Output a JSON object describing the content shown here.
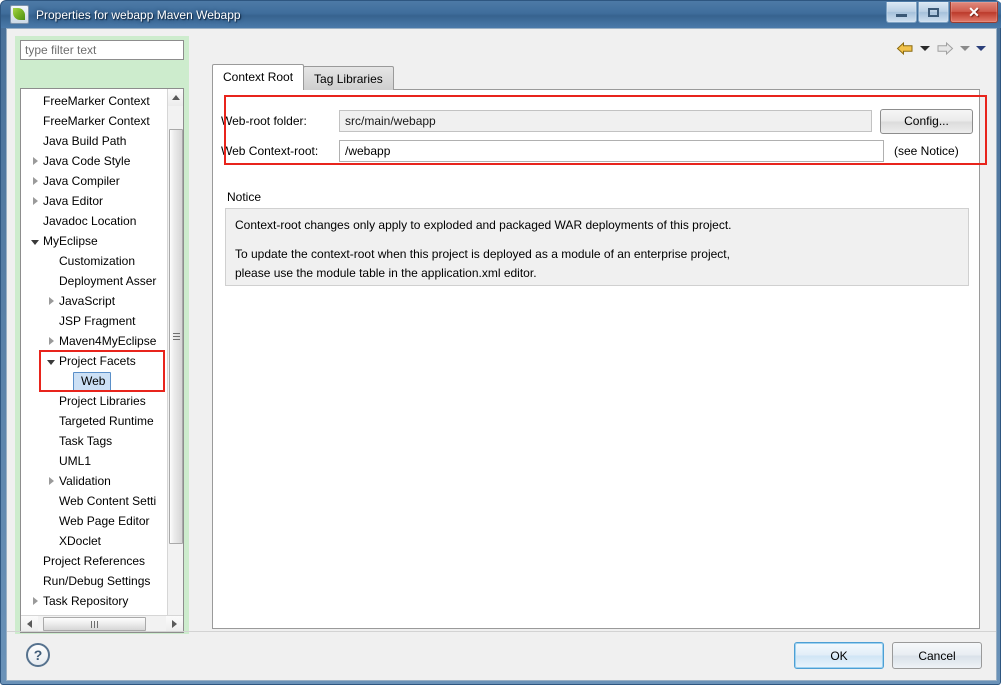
{
  "window": {
    "title": "Properties for webapp Maven Webapp",
    "icon": "myeclipse-leaf-icon",
    "minimize_label": "",
    "maximize_label": "",
    "close_label": "✕"
  },
  "filter": {
    "placeholder": "type filter text",
    "value": ""
  },
  "tree": {
    "items": [
      {
        "label": "FreeMarker Context",
        "indent": 1,
        "arrow": "none",
        "selected": false
      },
      {
        "label": "FreeMarker Context",
        "indent": 1,
        "arrow": "none",
        "selected": false
      },
      {
        "label": "Java Build Path",
        "indent": 1,
        "arrow": "none",
        "selected": false
      },
      {
        "label": "Java Code Style",
        "indent": 1,
        "arrow": "collapsed",
        "selected": false
      },
      {
        "label": "Java Compiler",
        "indent": 1,
        "arrow": "collapsed",
        "selected": false
      },
      {
        "label": "Java Editor",
        "indent": 1,
        "arrow": "collapsed",
        "selected": false
      },
      {
        "label": "Javadoc Location",
        "indent": 1,
        "arrow": "none",
        "selected": false
      },
      {
        "label": "MyEclipse",
        "indent": 1,
        "arrow": "expanded",
        "selected": false
      },
      {
        "label": "Customization",
        "indent": 2,
        "arrow": "none",
        "selected": false
      },
      {
        "label": "Deployment Asser",
        "indent": 2,
        "arrow": "none",
        "selected": false
      },
      {
        "label": "JavaScript",
        "indent": 2,
        "arrow": "collapsed",
        "selected": false
      },
      {
        "label": "JSP Fragment",
        "indent": 2,
        "arrow": "none",
        "selected": false
      },
      {
        "label": "Maven4MyEclipse",
        "indent": 2,
        "arrow": "collapsed",
        "selected": false
      },
      {
        "label": "Project Facets",
        "indent": 2,
        "arrow": "expanded",
        "selected": false
      },
      {
        "label": "Web",
        "indent": 3,
        "arrow": "none",
        "selected": true
      },
      {
        "label": "Project Libraries",
        "indent": 2,
        "arrow": "none",
        "selected": false
      },
      {
        "label": "Targeted Runtime",
        "indent": 2,
        "arrow": "none",
        "selected": false
      },
      {
        "label": "Task Tags",
        "indent": 2,
        "arrow": "none",
        "selected": false
      },
      {
        "label": "UML1",
        "indent": 2,
        "arrow": "none",
        "selected": false
      },
      {
        "label": "Validation",
        "indent": 2,
        "arrow": "collapsed",
        "selected": false
      },
      {
        "label": "Web Content Setti",
        "indent": 2,
        "arrow": "none",
        "selected": false
      },
      {
        "label": "Web Page Editor",
        "indent": 2,
        "arrow": "none",
        "selected": false
      },
      {
        "label": "XDoclet",
        "indent": 2,
        "arrow": "none",
        "selected": false
      },
      {
        "label": "Project References",
        "indent": 1,
        "arrow": "none",
        "selected": false
      },
      {
        "label": "Run/Debug Settings",
        "indent": 1,
        "arrow": "none",
        "selected": false
      },
      {
        "label": "Task Repository",
        "indent": 1,
        "arrow": "collapsed",
        "selected": false
      }
    ]
  },
  "nav": {
    "back_icon": "back-arrow-icon",
    "back_menu_icon": "chevron-down-icon",
    "forward_icon": "forward-arrow-icon",
    "forward_menu_icon": "chevron-down-icon",
    "view_menu_icon": "chevron-down-icon"
  },
  "tabs": [
    {
      "label": "Context Root",
      "active": true
    },
    {
      "label": "Tag Libraries",
      "active": false
    }
  ],
  "form": {
    "webroot_label": "Web-root folder:",
    "webroot_value": "src/main/webapp",
    "context_label": "Web Context-root:",
    "context_value": "/webapp",
    "config_button": "Config...",
    "see_notice": "(see Notice)"
  },
  "notice": {
    "heading": "Notice",
    "line1": "Context-root changes only apply to exploded and packaged WAR deployments of this project.",
    "line2": "To update the context-root when this project is deployed as a module of an enterprise project,",
    "line3": "please use the module table in the application.xml editor."
  },
  "footer": {
    "help_glyph": "?",
    "ok_label": "OK",
    "cancel_label": "Cancel"
  },
  "colors": {
    "annotation_red": "#e8241c",
    "title_gradient_top": "#4d7aa6",
    "filter_highlight_green": "#cdeccd",
    "selection_blue": "#cce0f5",
    "close_red": "#cf5b4c"
  }
}
